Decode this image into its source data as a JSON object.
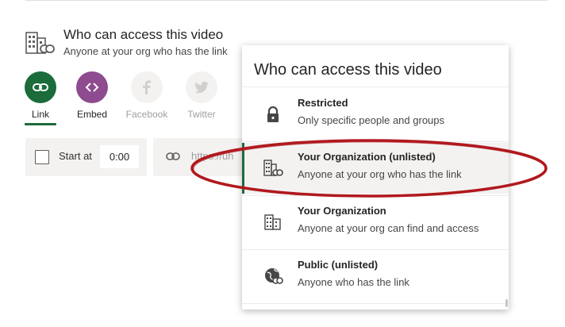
{
  "header": {
    "title": "Who can access this video",
    "subtitle": "Anyone at your org who has the link"
  },
  "share_targets": [
    {
      "label": "Link",
      "icon": "link-icon",
      "color": "#1b6b3b",
      "active": true
    },
    {
      "label": "Embed",
      "icon": "embed-code-icon",
      "color": "#8e4b8f",
      "active": false
    },
    {
      "label": "Facebook",
      "icon": "facebook-icon",
      "color": "#f3f2f1",
      "active": false
    },
    {
      "label": "Twitter",
      "icon": "twitter-icon",
      "color": "#f3f2f1",
      "active": false
    }
  ],
  "start_at": {
    "label": "Start at",
    "value": "0:00",
    "checked": false
  },
  "url_field": {
    "value": "https://uh"
  },
  "dropdown": {
    "title": "Who can access this video",
    "options": [
      {
        "title": "Restricted",
        "subtitle": "Only specific people and groups",
        "icon": "lock-icon",
        "selected": false
      },
      {
        "title": "Your Organization (unlisted)",
        "subtitle": "Anyone at your org who has the link",
        "icon": "building-link-icon",
        "selected": true
      },
      {
        "title": "Your Organization",
        "subtitle": "Anyone at your org can find and access",
        "icon": "building-icon",
        "selected": false
      },
      {
        "title": "Public (unlisted)",
        "subtitle": "Anyone who has the link",
        "icon": "globe-link-icon",
        "selected": false
      }
    ]
  },
  "colors": {
    "accent": "#1b6b3b",
    "annotation": "#b0191e",
    "embed": "#8e4b8f"
  }
}
